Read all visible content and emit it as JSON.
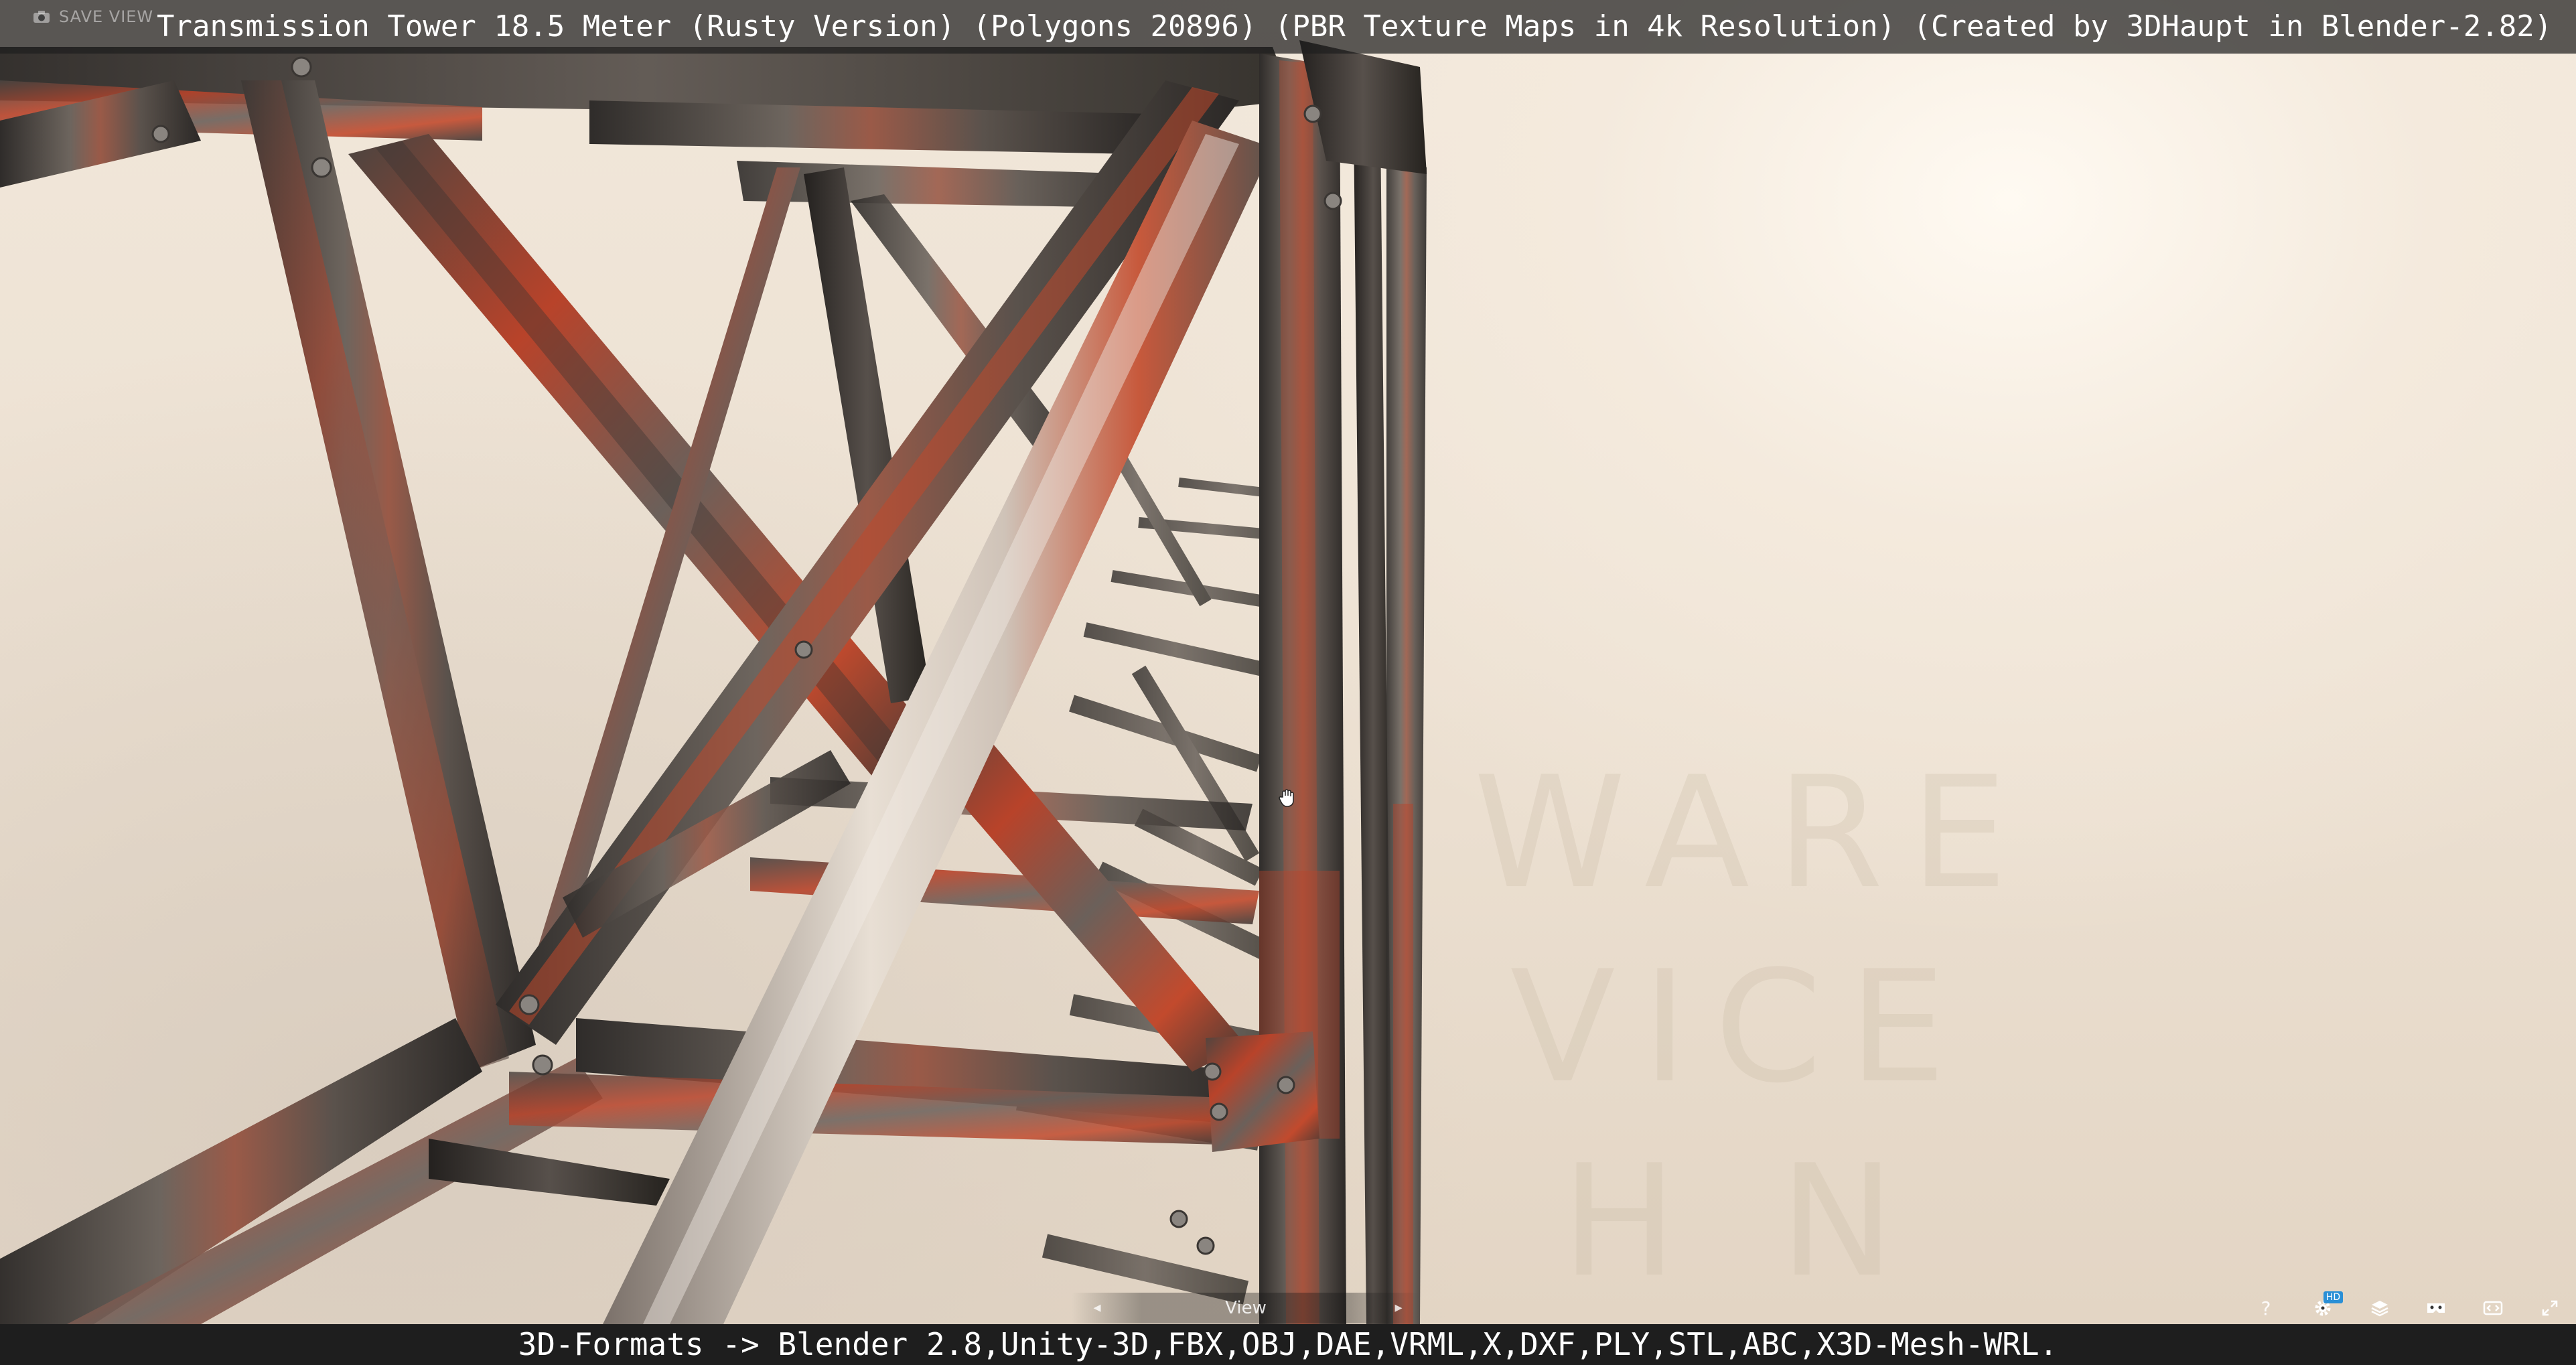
{
  "viewer": {
    "title": "Transmission Tower 18.5 Meter (Rusty Version) (Polygons 20896) (PBR Texture Maps in 4k Resolution) (Created by 3DHaupt in Blender-2.82)",
    "save_view_label": "SAVE VIEW",
    "formats_caption": "3D-Formats -> Blender 2.8,Unity-3D,FBX,OBJ,DAE,VRML,X,DXF,PLY,STL,ABC,X3D-Mesh-WRL.",
    "view_label": "View",
    "watermark_lines": [
      "WARE",
      "VICE",
      "H N"
    ],
    "hd_badge": "HD"
  },
  "toolbar": {
    "items": [
      {
        "name": "help",
        "icon": "question-icon",
        "glyph": "?"
      },
      {
        "name": "settings",
        "icon": "gear-icon"
      },
      {
        "name": "layers",
        "icon": "layers-icon"
      },
      {
        "name": "vr",
        "icon": "vr-headset-icon"
      },
      {
        "name": "embed",
        "icon": "embed-icon"
      },
      {
        "name": "fullscreen",
        "icon": "fullscreen-icon"
      }
    ]
  },
  "colors": {
    "bar_bg": "#1e1e1e",
    "title_bg": "rgba(30,30,30,0.72)",
    "rust": "#b8432a",
    "steel": "#4e4a46",
    "sky": "#f4eadd"
  }
}
